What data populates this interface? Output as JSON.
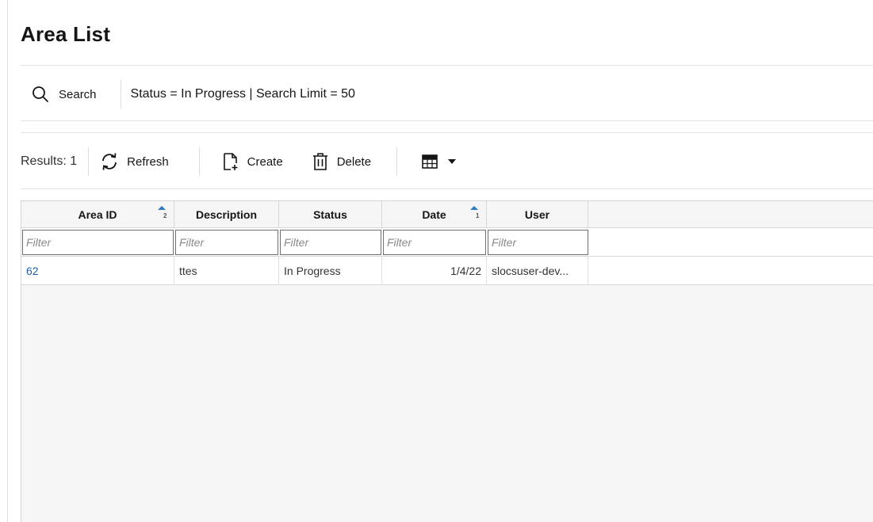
{
  "page": {
    "title": "Area List"
  },
  "search": {
    "label": "Search",
    "criteria": "Status = In Progress | Search Limit = 50"
  },
  "toolbar": {
    "results": "Results: 1",
    "refresh_label": "Refresh",
    "create_label": "Create",
    "delete_label": "Delete"
  },
  "table": {
    "columns": [
      {
        "label": "Area ID",
        "sort": "ascending",
        "sort_priority": "2"
      },
      {
        "label": "Description"
      },
      {
        "label": "Status"
      },
      {
        "label": "Date",
        "sort": "ascending",
        "sort_priority": "1"
      },
      {
        "label": "User"
      }
    ],
    "filter_placeholder": "Filter",
    "rows": [
      {
        "area_id": "62",
        "description": "ttes",
        "status": "In Progress",
        "date": "1/4/22",
        "user": "slocsuser-dev..."
      }
    ]
  },
  "colors": {
    "link": "#1f5fa8",
    "sort_indicator": "#2d7bc4",
    "header_bg": "#f5f5f5"
  }
}
